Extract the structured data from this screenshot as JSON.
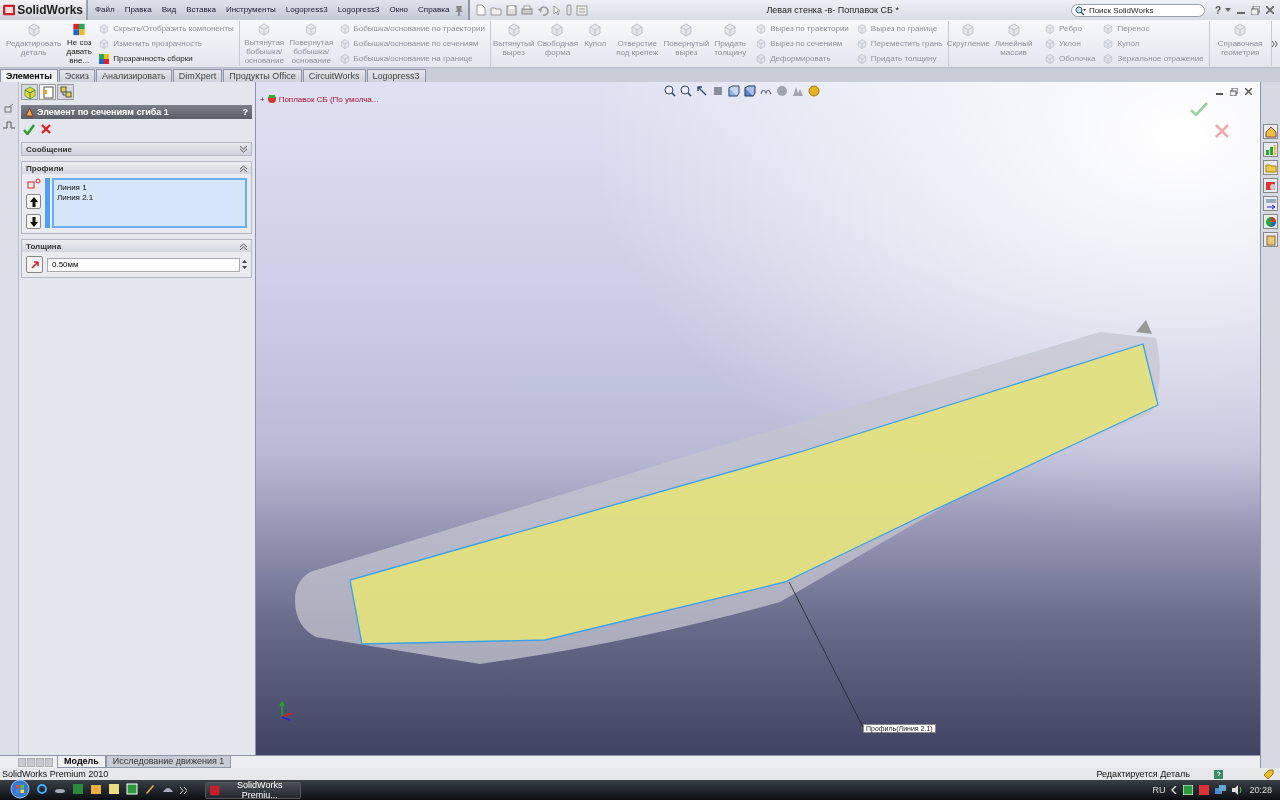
{
  "title_bar": {
    "logo": "SolidWorks",
    "menu": [
      "Файл",
      "Правка",
      "Вид",
      "Вставка",
      "Инструменты",
      "Logopress3",
      "Logopress3",
      "Окно",
      "Справка"
    ],
    "document_title": "Левая стенка -в- Поплавок СБ *",
    "search": {
      "placeholder": "Поиск SolidWorks"
    },
    "help": "?"
  },
  "ribbon": {
    "groups": [
      {
        "columns": [
          {
            "kind": "large",
            "label": "Редактировать деталь",
            "disabled": true
          },
          {
            "kind": "large",
            "label": "Не создавать вне...",
            "disabled": false
          },
          {
            "kind": "stack",
            "items": [
              {
                "label": "Скрыть/Отобразить компоненты",
                "disabled": true
              },
              {
                "label": "Изменить прозрачность",
                "disabled": true
              },
              {
                "label": "Прозрачность сборки",
                "disabled": false
              }
            ]
          }
        ]
      },
      {
        "columns": [
          {
            "kind": "large",
            "label": "Вытянутая бобышка/основание",
            "disabled": true
          },
          {
            "kind": "large",
            "label": "Повернутая бобышка/основание",
            "disabled": true
          },
          {
            "kind": "stack",
            "items": [
              {
                "label": "Бобышка/основание по траектории",
                "disabled": true
              },
              {
                "label": "Бобышка/основание по сечениям",
                "disabled": true
              },
              {
                "label": "Бобышка/основание на границе",
                "disabled": true
              }
            ]
          }
        ]
      },
      {
        "columns": [
          {
            "kind": "large",
            "label": "Вытянутый вырез",
            "disabled": true
          },
          {
            "kind": "large",
            "label": "Свободная форма",
            "disabled": true
          },
          {
            "kind": "large",
            "label": "Купол",
            "disabled": true
          },
          {
            "kind": "large",
            "label": "Отверстие под крепеж",
            "disabled": true
          },
          {
            "kind": "large",
            "label": "Повернутый вырез",
            "disabled": true
          },
          {
            "kind": "large",
            "label": "Придать толщину",
            "disabled": true
          },
          {
            "kind": "stack",
            "items": [
              {
                "label": "Вырез по траектории",
                "disabled": true
              },
              {
                "label": "Вырез по сечениям",
                "disabled": true
              },
              {
                "label": "Деформировать",
                "disabled": true
              }
            ]
          },
          {
            "kind": "stack",
            "items": [
              {
                "label": "Вырез по границе",
                "disabled": true
              },
              {
                "label": "Переместить грань",
                "disabled": true
              },
              {
                "label": "Придать толщину",
                "disabled": true
              }
            ]
          }
        ]
      },
      {
        "columns": [
          {
            "kind": "large",
            "label": "Скругление",
            "disabled": true
          },
          {
            "kind": "large",
            "label": "Линейный массив",
            "disabled": true
          },
          {
            "kind": "stack",
            "items": [
              {
                "label": "Ребро",
                "disabled": true
              },
              {
                "label": "Уклон",
                "disabled": true
              },
              {
                "label": "Оболочка",
                "disabled": true
              }
            ]
          },
          {
            "kind": "stack",
            "items": [
              {
                "label": "Перенос",
                "disabled": true
              },
              {
                "label": "Купол",
                "disabled": true
              },
              {
                "label": "Зеркальное отражение",
                "disabled": true
              }
            ]
          }
        ]
      },
      {
        "columns": [
          {
            "kind": "large",
            "label": "Справочная геометрия",
            "disabled": true
          }
        ]
      }
    ]
  },
  "tabs": [
    {
      "label": "Элементы",
      "selected": true
    },
    {
      "label": "Эскиз",
      "selected": false
    },
    {
      "label": "Анализировать",
      "selected": false
    },
    {
      "label": "DimXpert",
      "selected": false
    },
    {
      "label": "Продукты Office",
      "selected": false
    },
    {
      "label": "CircuitWorks",
      "selected": false
    },
    {
      "label": "Logopress3",
      "selected": false
    }
  ],
  "property_manager": {
    "tabs": [
      {
        "kind": "feature_tree",
        "selected": false
      },
      {
        "kind": "property",
        "selected": true
      },
      {
        "kind": "configuration",
        "selected": false
      }
    ],
    "title": "Элемент по сечениям сгиба 1",
    "help": "?",
    "sections": [
      {
        "kind": "message",
        "title": "Сообщение",
        "expanded": false
      },
      {
        "kind": "profiles",
        "title": "Профили",
        "expanded": true,
        "items": [
          "Линия 1",
          "Линия 2.1"
        ]
      },
      {
        "kind": "thickness",
        "title": "Толщина",
        "expanded": true,
        "value": "0.50мм"
      }
    ]
  },
  "viewport": {
    "tree_toggle": "+",
    "tree_root": "Поплавок СБ  (По умолча...",
    "callout": "Профиль(Линия 2.1)"
  },
  "bottom_tabs": [
    {
      "label": "Модель",
      "selected": true
    },
    {
      "label": "Исследование движения 1",
      "selected": false
    }
  ],
  "status_bar": {
    "product": "SolidWorks Premium 2010",
    "mode": "Редактируется Деталь"
  },
  "taskbar": {
    "task": "SolidWorks Premiu...",
    "language": "RU",
    "clock": "20:28"
  }
}
